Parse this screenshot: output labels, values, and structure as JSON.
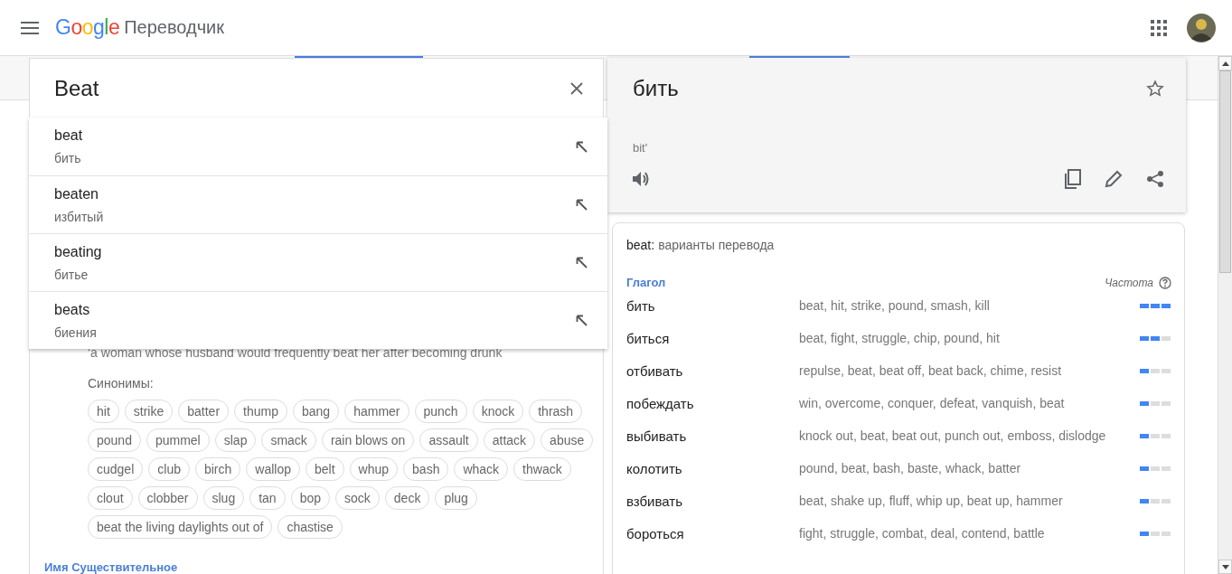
{
  "header": {
    "logo": "Google",
    "product": "Переводчик"
  },
  "source": {
    "value": "Beat"
  },
  "suggestions": [
    {
      "word": "beat",
      "translation": "бить"
    },
    {
      "word": "beaten",
      "translation": "избитый"
    },
    {
      "word": "beating",
      "translation": "битье"
    },
    {
      "word": "beats",
      "translation": "биения"
    }
  ],
  "example": "‘a woman whose husband would frequently beat her after becoming drunk",
  "synonyms_label": "Синонимы:",
  "synonyms": [
    "hit",
    "strike",
    "batter",
    "thump",
    "bang",
    "hammer",
    "punch",
    "knock",
    "thrash",
    "pound",
    "pummel",
    "slap",
    "smack",
    "rain blows on",
    "assault",
    "attack",
    "abuse",
    "cudgel",
    "club",
    "birch",
    "wallop",
    "belt",
    "whup",
    "bash",
    "whack",
    "thwack",
    "clout",
    "clobber",
    "slug",
    "tan",
    "bop",
    "sock",
    "deck",
    "plug",
    "beat the living daylights out of",
    "chastise"
  ],
  "next_part_of_speech": "Имя Существительное",
  "translation": {
    "text": "бить",
    "transliteration": "bit'"
  },
  "dictionary": {
    "word": "beat:",
    "title": "варианты перевода",
    "part_of_speech": "Глагол",
    "frequency_label": "Частота",
    "rows": [
      {
        "term": "бить",
        "synonyms": "beat, hit, strike, pound, smash, kill",
        "level": 1
      },
      {
        "term": "биться",
        "synonyms": "beat, fight, struggle, chip, pound, hit",
        "level": 0.67
      },
      {
        "term": "отбивать",
        "synonyms": "repulse, beat, beat off, beat back, chime, resist",
        "level": 0.33
      },
      {
        "term": "побеждать",
        "synonyms": "win, overcome, conquer, defeat, vanquish, beat",
        "level": 0.33
      },
      {
        "term": "выбивать",
        "synonyms": "knock out, beat, beat out, punch out, emboss, dislodge",
        "level": 0.33
      },
      {
        "term": "колотить",
        "synonyms": "pound, beat, bash, baste, whack, batter",
        "level": 0.33
      },
      {
        "term": "взбивать",
        "synonyms": "beat, shake up, fluff, whip up, beat up, hammer",
        "level": 0.33
      },
      {
        "term": "бороться",
        "synonyms": "fight, struggle, combat, deal, contend, battle",
        "level": 0.33
      }
    ]
  }
}
